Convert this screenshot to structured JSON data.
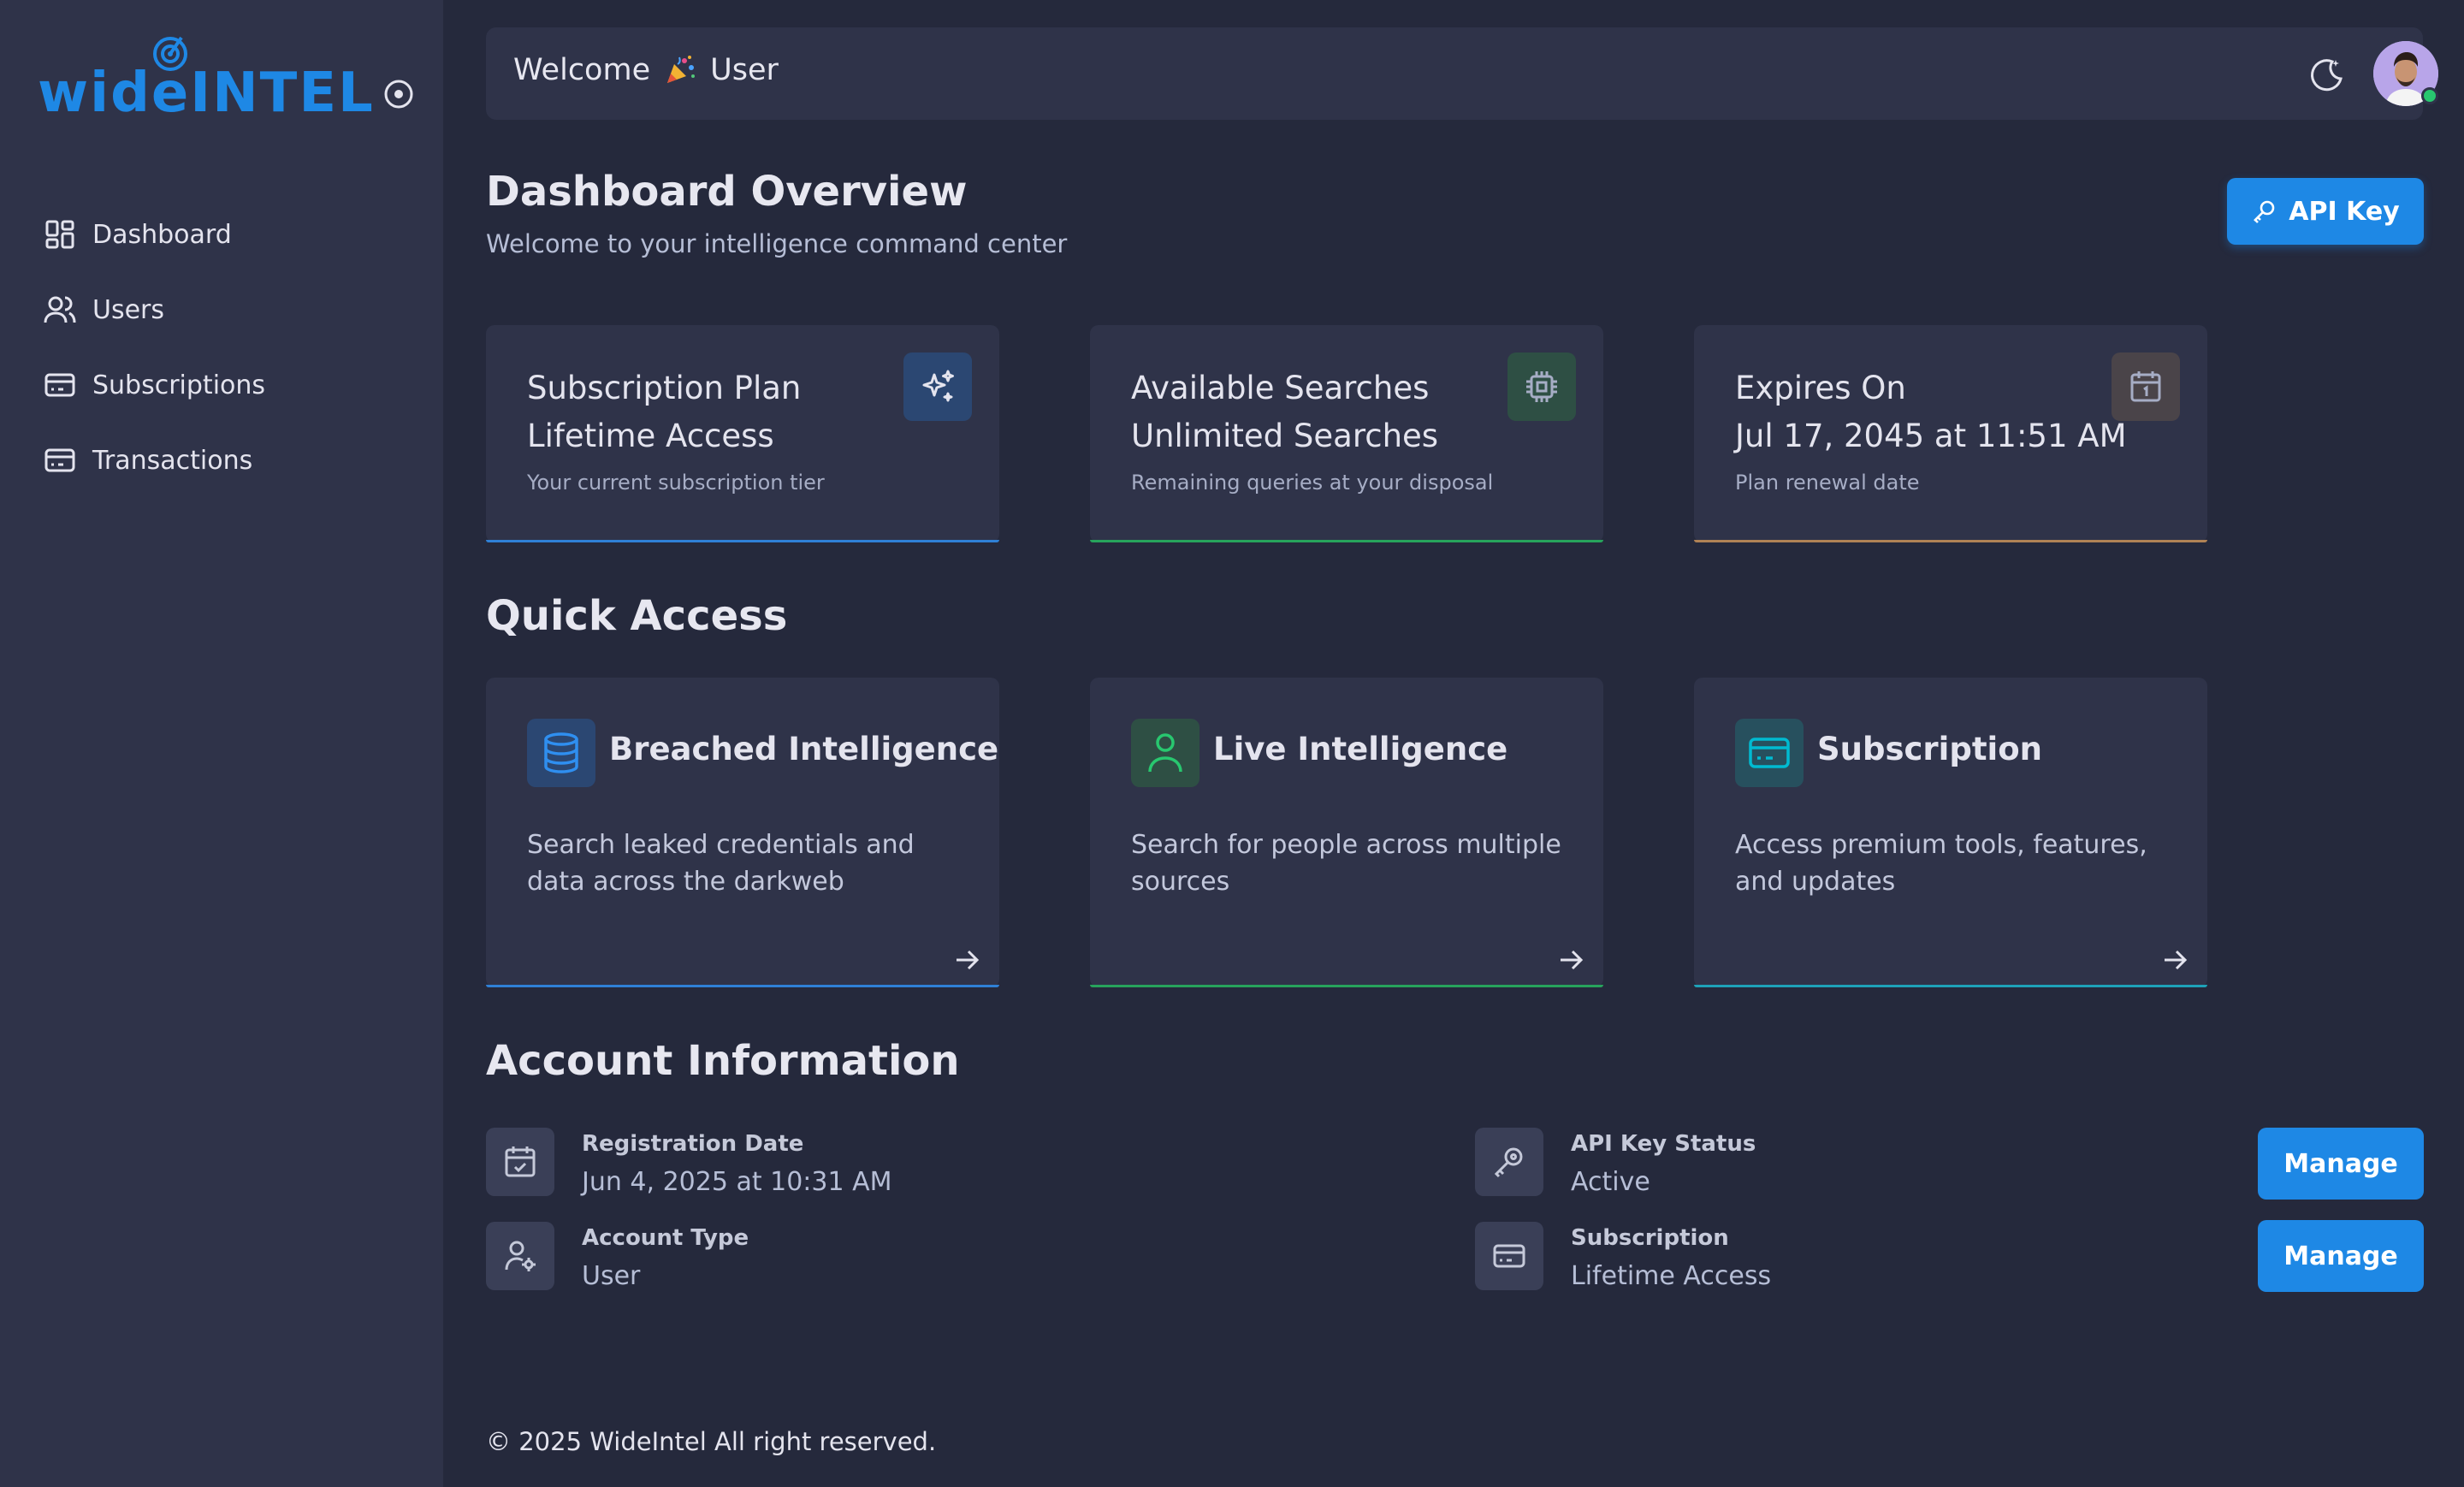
{
  "brand": {
    "name": "wideINTEL",
    "accent": "#1e88e5"
  },
  "sidebar": {
    "items": [
      {
        "label": "Dashboard",
        "icon": "dashboard-icon"
      },
      {
        "label": "Users",
        "icon": "users-icon"
      },
      {
        "label": "Subscriptions",
        "icon": "card-icon"
      },
      {
        "label": "Transactions",
        "icon": "card-icon"
      }
    ]
  },
  "header": {
    "welcome_prefix": "Welcome",
    "welcome_user": "User"
  },
  "page": {
    "title": "Dashboard Overview",
    "subtitle": "Welcome to your intelligence command center",
    "api_key_label": "API Key"
  },
  "stats": [
    {
      "label": "Subscription Plan",
      "value": "Lifetime Access",
      "desc": "Your current subscription tier",
      "icon": "sparkles-icon",
      "accent": "#2f80d6"
    },
    {
      "label": "Available Searches",
      "value": "Unlimited Searches",
      "desc": "Remaining queries at your disposal",
      "icon": "cpu-icon",
      "accent": "#27a35c"
    },
    {
      "label": "Expires On",
      "value": "Jul 17, 2045 at 11:51 AM",
      "desc": "Plan renewal date",
      "icon": "calendar-icon",
      "accent": "#b08255"
    }
  ],
  "quick_access": {
    "title": "Quick Access",
    "cards": [
      {
        "title": "Breached Intelligence",
        "desc": "Search leaked credentials and data across the darkweb",
        "icon": "database-icon",
        "accent": "#2f80d6"
      },
      {
        "title": "Live Intelligence",
        "desc": "Search for people across multiple sources",
        "icon": "person-icon",
        "accent": "#27a35c"
      },
      {
        "title": "Subscription",
        "desc": "Access premium tools, features, and updates",
        "icon": "credit-card-icon",
        "accent": "#1ea2b8"
      }
    ]
  },
  "account": {
    "title": "Account Information",
    "registration": {
      "key": "Registration Date",
      "value": "Jun 4, 2025 at 10:31 AM"
    },
    "account_type": {
      "key": "Account Type",
      "value": "User"
    },
    "api_status": {
      "key": "API Key Status",
      "value": "Active"
    },
    "subscription": {
      "key": "Subscription",
      "value": "Lifetime Access"
    },
    "manage_label": "Manage"
  },
  "footer": {
    "text": "© 2025 WideIntel All right reserved."
  }
}
